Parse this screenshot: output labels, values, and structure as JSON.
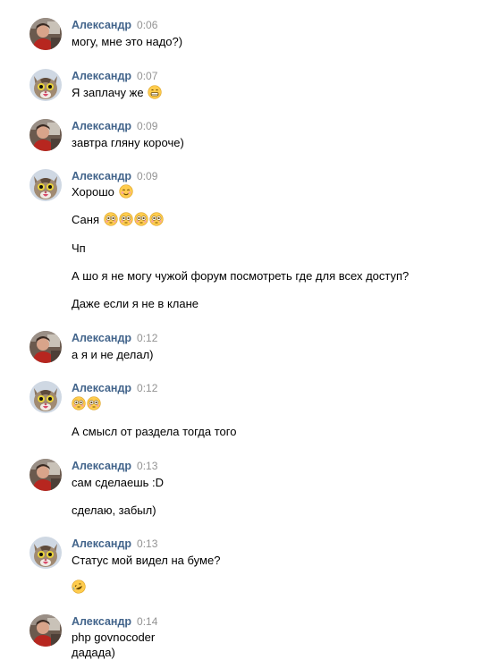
{
  "messages": [
    {
      "avatar": "avatar-alexander-photo",
      "author": "Александр",
      "time": "0:06",
      "lines": [
        {
          "text": "могу, мне это надо?)",
          "emojis": []
        }
      ]
    },
    {
      "avatar": "avatar-cat",
      "author": "Александр",
      "time": "0:07",
      "lines": [
        {
          "text": "Я заплачу же",
          "emojis": [
            "grin"
          ]
        }
      ]
    },
    {
      "avatar": "avatar-alexander-photo",
      "author": "Александр",
      "time": "0:09",
      "lines": [
        {
          "text": "завтра гляну короче)",
          "emojis": []
        }
      ]
    },
    {
      "avatar": "avatar-cat",
      "author": "Александр",
      "time": "0:09",
      "lines": [
        {
          "text": "Хорошо",
          "emojis": [
            "blush"
          ]
        },
        {
          "text": "Саня",
          "emojis": [
            "flushed",
            "flushed",
            "flushed",
            "flushed"
          ]
        },
        {
          "text": "Чп",
          "emojis": []
        },
        {
          "text": "А шо я не могу чужой форум посмотреть где для всех доступ?",
          "emojis": []
        },
        {
          "text": "Даже если я не в клане",
          "emojis": []
        }
      ]
    },
    {
      "avatar": "avatar-alexander-photo",
      "author": "Александр",
      "time": "0:12",
      "lines": [
        {
          "text": "а я и не делал)",
          "emojis": []
        }
      ]
    },
    {
      "avatar": "avatar-cat",
      "author": "Александр",
      "time": "0:12",
      "lines": [
        {
          "text": "",
          "emojis": [
            "flushed",
            "flushed"
          ]
        },
        {
          "text": "А смысл от раздела тогда того",
          "emojis": []
        }
      ]
    },
    {
      "avatar": "avatar-alexander-photo",
      "author": "Александр",
      "time": "0:13",
      "lines": [
        {
          "text": "сам сделаешь :D",
          "emojis": []
        },
        {
          "text": "сделаю, забыл)",
          "emojis": []
        }
      ]
    },
    {
      "avatar": "avatar-cat",
      "author": "Александр",
      "time": "0:13",
      "lines": [
        {
          "text": "Статус мой видел на буме?",
          "emojis": []
        },
        {
          "text": "",
          "emojis": [
            "rofl"
          ]
        }
      ]
    },
    {
      "avatar": "avatar-alexander-photo",
      "author": "Александр",
      "time": "0:14",
      "lines": [
        {
          "text": "php govnocoder",
          "emojis": []
        },
        {
          "text": "дадада)",
          "emojis": []
        }
      ]
    }
  ],
  "colors": {
    "author": "#42648b",
    "time": "#939393",
    "text": "#000000"
  }
}
